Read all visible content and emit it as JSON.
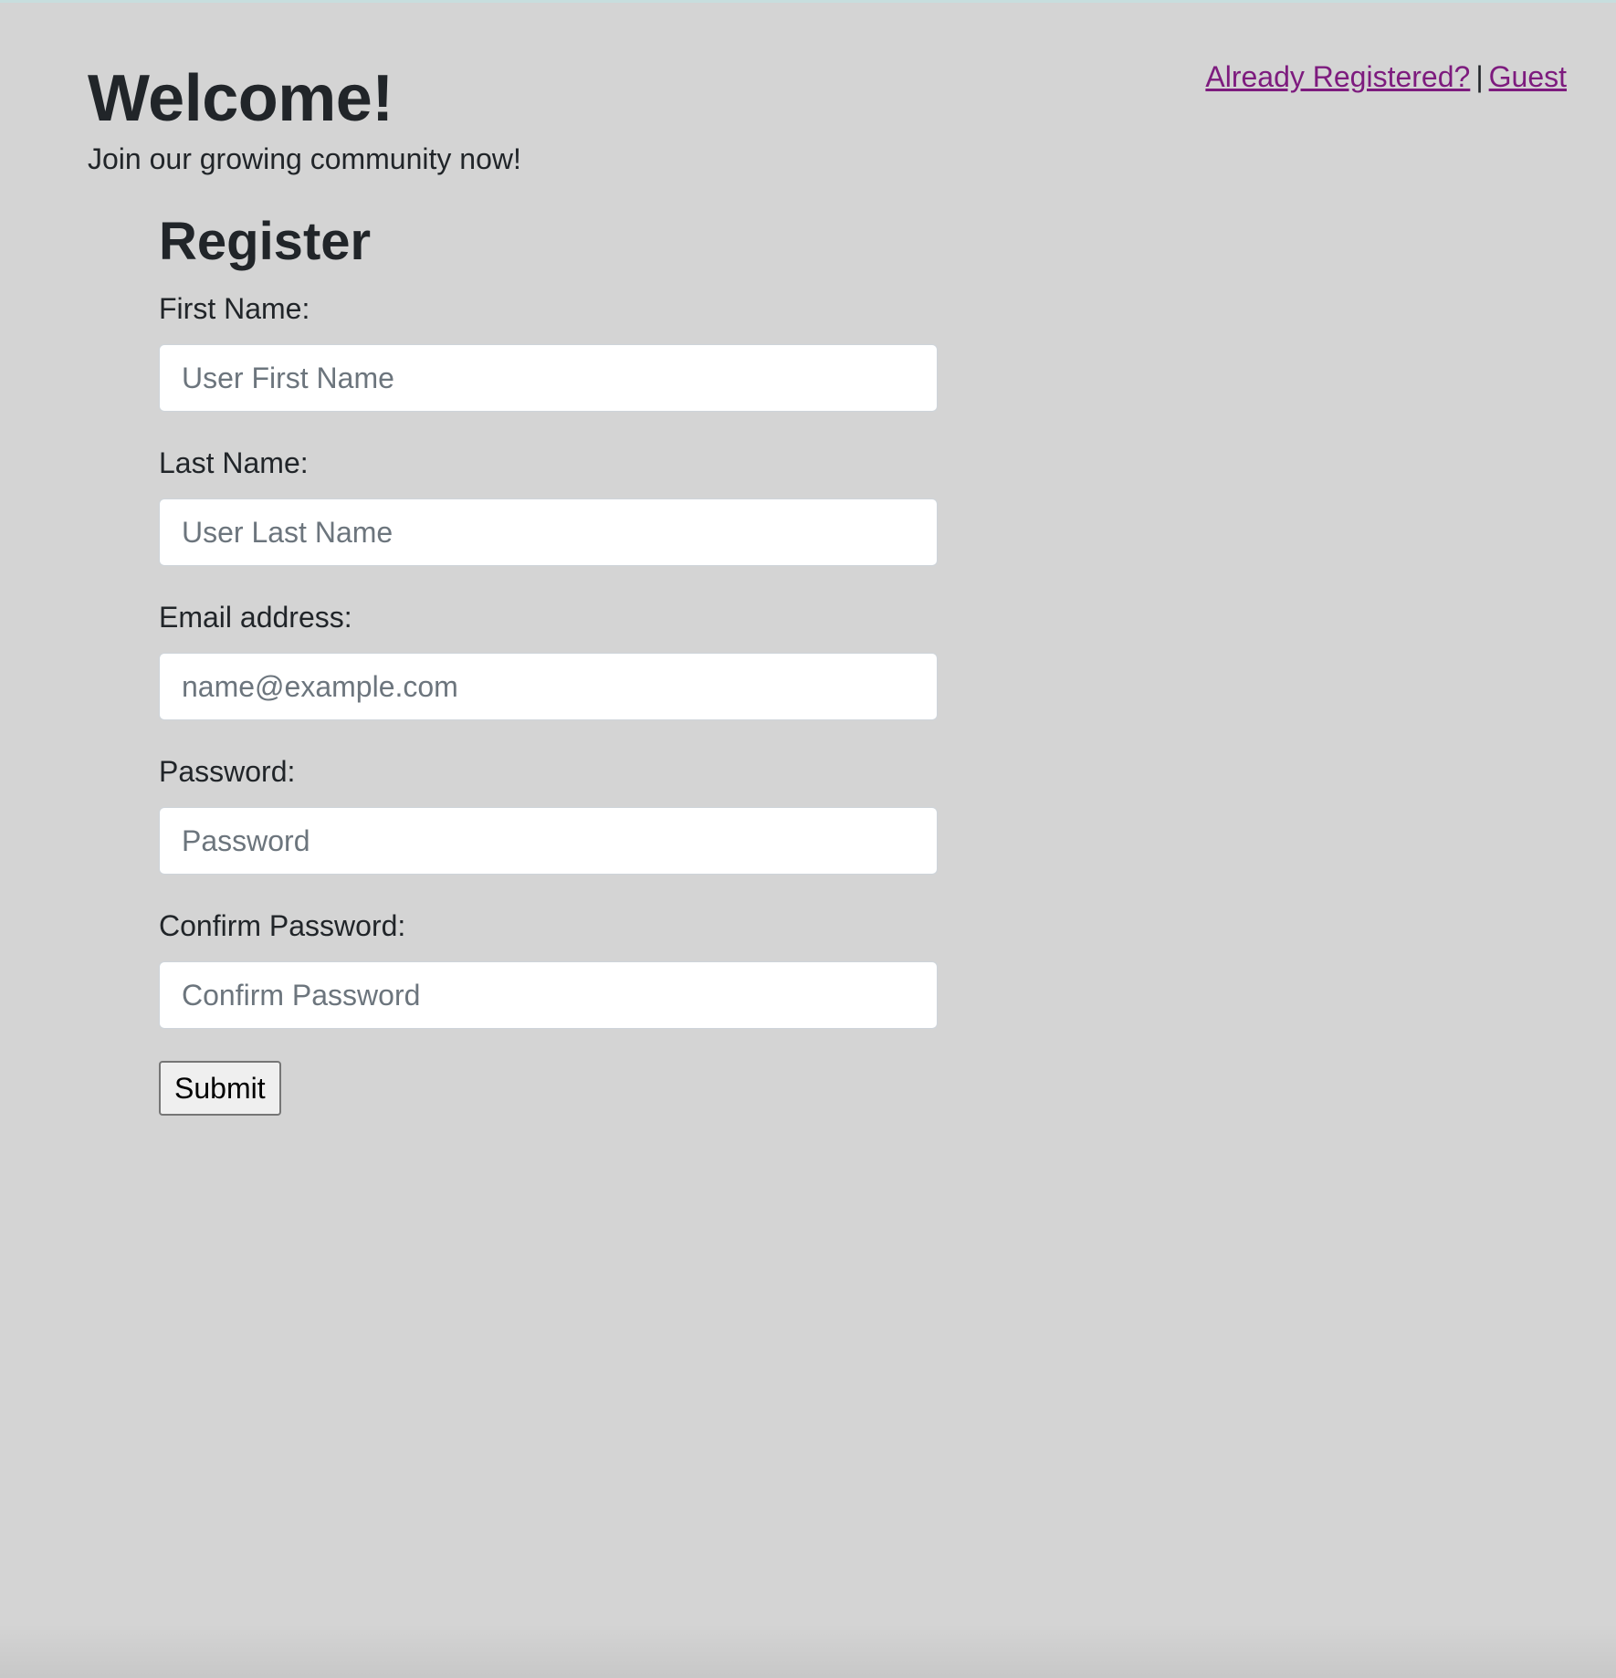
{
  "header": {
    "already_registered_label": "Already Registered?",
    "separator": "|",
    "guest_label": "Guest"
  },
  "hero": {
    "title": "Welcome!",
    "subtitle": "Join our growing community now!"
  },
  "form": {
    "title": "Register",
    "fields": [
      {
        "label": "First Name:",
        "placeholder": "User First Name",
        "value": "",
        "type": "text"
      },
      {
        "label": "Last Name:",
        "placeholder": "User Last Name",
        "value": "",
        "type": "text"
      },
      {
        "label": "Email address:",
        "placeholder": "name@example.com",
        "value": "",
        "type": "email"
      },
      {
        "label": "Password:",
        "placeholder": "Password",
        "value": "",
        "type": "password"
      },
      {
        "label": "Confirm Password:",
        "placeholder": "Confirm Password",
        "value": "",
        "type": "password"
      }
    ],
    "submit_label": "Submit"
  },
  "colors": {
    "background": "#d4d4d4",
    "link": "#7d1b7e",
    "text": "#212529",
    "placeholder": "#6c757d"
  }
}
